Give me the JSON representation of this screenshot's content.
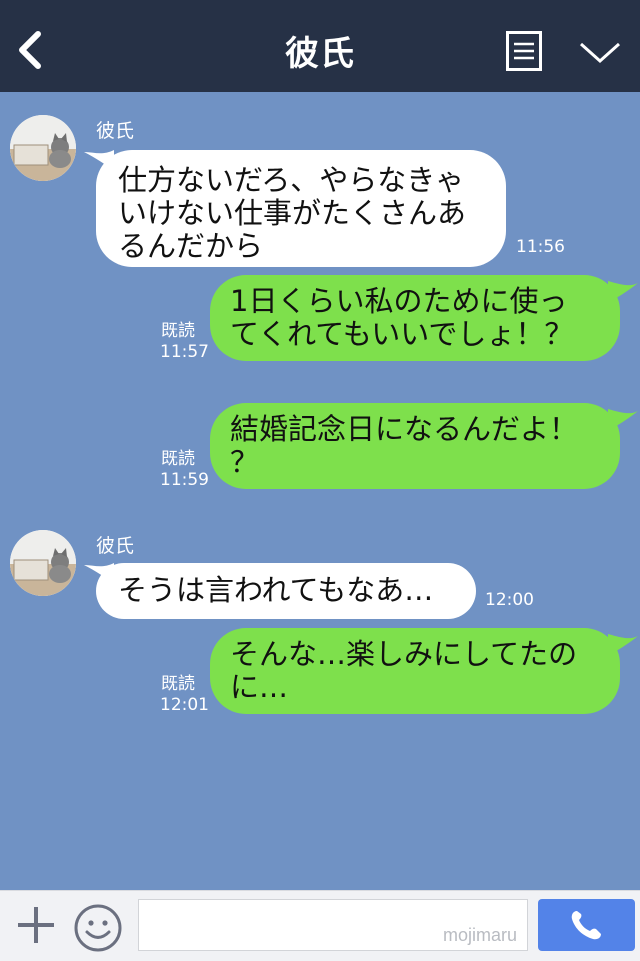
{
  "header": {
    "title": "彼氏"
  },
  "messages": [
    {
      "side": "in",
      "sender": "彼氏",
      "lines": [
        "仕方ないだろ、やらなきゃ",
        "いけない仕事がたくさんあ",
        "るんだから"
      ],
      "time": "11:56"
    },
    {
      "side": "out",
      "read": "既読",
      "lines": [
        "1日くらい私のために使っ",
        "てくれてもいいでしょ！？"
      ],
      "time": "11:57"
    },
    {
      "side": "out",
      "read": "既読",
      "lines": [
        "結婚記念日になるんだよ！",
        "？"
      ],
      "time": "11:59"
    },
    {
      "side": "in",
      "sender": "彼氏",
      "lines": [
        "そうは言われてもなあ…"
      ],
      "time": "12:00"
    },
    {
      "side": "out",
      "read": "既読",
      "lines": [
        "そんな…楽しみにしてたの",
        "に…"
      ],
      "time": "12:01"
    }
  ],
  "input": {
    "watermark": "mojimaru"
  },
  "colors": {
    "header_bg": "#263146",
    "chat_bg": "#7092c4",
    "incoming_bubble": "#ffffff",
    "outgoing_bubble": "#7ee04c",
    "send_button": "#5383e8"
  },
  "icons": [
    "back-icon",
    "menu-icon",
    "chevron-down-icon",
    "plus-icon",
    "smile-icon",
    "phone-icon"
  ]
}
